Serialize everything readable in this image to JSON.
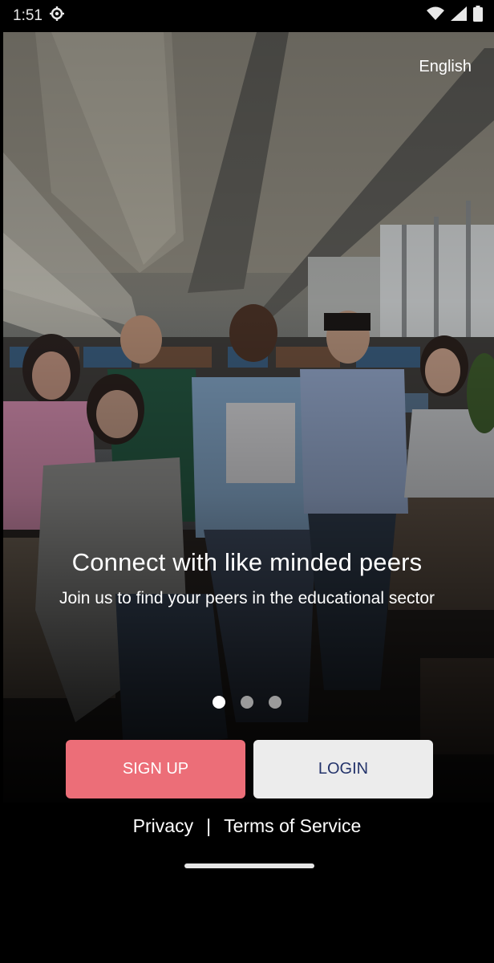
{
  "status_bar": {
    "time": "1:51"
  },
  "header": {
    "language": "English"
  },
  "onboarding": {
    "title": "Connect with like minded peers",
    "subtitle": "Join us to find your peers in the educational sector",
    "pages": 3,
    "active_page": 1
  },
  "actions": {
    "signup_label": "SIGN UP",
    "login_label": "LOGIN"
  },
  "footer": {
    "privacy": "Privacy",
    "separator": "|",
    "terms": "Terms of Service"
  },
  "colors": {
    "signup_bg": "#ec6e78",
    "login_bg": "#ececec",
    "login_text": "#24346b"
  }
}
